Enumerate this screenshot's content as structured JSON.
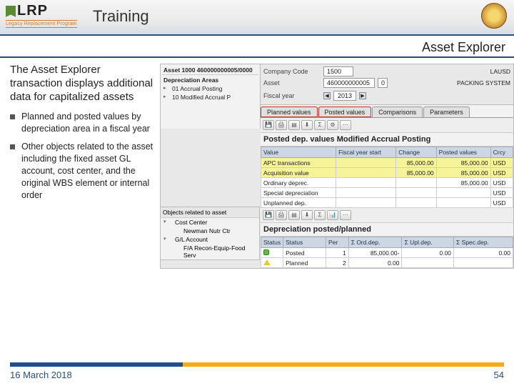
{
  "header": {
    "logo": "LRP",
    "logo_sub": "Legacy Replacement Program",
    "title": "Training"
  },
  "section_title": "Asset Explorer",
  "intro": "The Asset Explorer transaction displays additional data for capitalized assets",
  "bullets": [
    "Planned and posted values by depreciation area in a fiscal year",
    "Other objects related to the asset including the fixed asset GL account, cost center, and the original WBS element or internal order"
  ],
  "top": {
    "asset_hdr": "Asset 1000 460000000005/0000",
    "company_lbl": "Company Code",
    "company_val": "1500",
    "company_name": "LAUSD",
    "asset_lbl": "Asset",
    "asset_val": "460000000005",
    "asset_sub": "0",
    "asset_name": "PACKING SYSTEM",
    "fy_lbl": "Fiscal year",
    "fy_val": "2013"
  },
  "tree": {
    "hdr": "Depreciation Areas",
    "n1": "01 Accrual Posting",
    "n2": "10 Modified Accrual P"
  },
  "tabs": {
    "t1": "Planned values",
    "t2": "Posted values",
    "t3": "Comparisons",
    "t4": "Parameters"
  },
  "posted_title": "Posted dep. values Modified Accrual Posting",
  "posted_cols": {
    "c1": "Value",
    "c2": "Fiscal year start",
    "c3": "Change",
    "c4": "Posted values",
    "c5": "Crcy"
  },
  "posted_rows": [
    {
      "v": "APC transactions",
      "fy": "",
      "ch": "85,000.00",
      "pv": "85,000.00",
      "cr": "USD"
    },
    {
      "v": "Acquisition value",
      "fy": "",
      "ch": "85,000.00",
      "pv": "85,000.00",
      "cr": "USD"
    },
    {
      "v": "Ordinary deprec.",
      "fy": "",
      "ch": "",
      "pv": "85,000.00",
      "cr": "USD"
    },
    {
      "v": "Special depreciation",
      "fy": "",
      "ch": "",
      "pv": "",
      "cr": "USD"
    },
    {
      "v": "Unplanned dep.",
      "fy": "",
      "ch": "",
      "pv": "",
      "cr": "USD"
    }
  ],
  "dep_title": "Depreciation posted/planned",
  "dep_cols": {
    "c1": "Status",
    "c2": "Status",
    "c3": "Per",
    "c4": "Σ Ord.dep.",
    "c5": "Σ Upl.dep.",
    "c6": "Σ Spec.dep."
  },
  "dep_rows": [
    {
      "st": "green",
      "label": "Posted",
      "per": "1",
      "ord": "85,000.00-",
      "upl": "0.00",
      "spec": "0.00"
    },
    {
      "st": "yel",
      "label": "Planned",
      "per": "2",
      "ord": "0.00",
      "upl": "",
      "spec": ""
    }
  ],
  "obj": {
    "hdr": "Objects related to asset",
    "n1": "Cost Center",
    "l1": "Newman Nutr Ctr",
    "n2": "G/L Account",
    "l2": "F/A Recon-Equip-Food Serv"
  },
  "footer": {
    "date": "16 March 2018",
    "page": "54"
  }
}
